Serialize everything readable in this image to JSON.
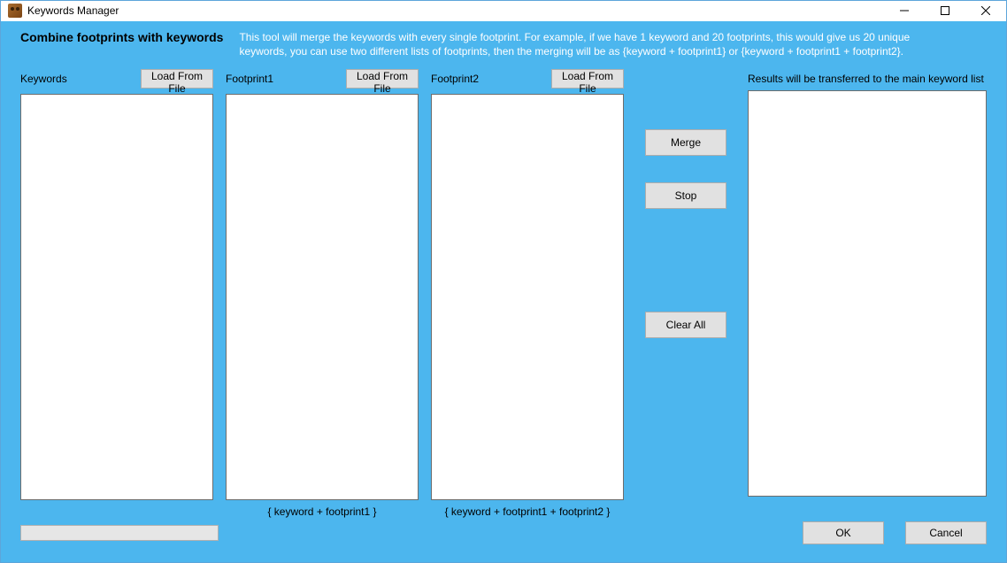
{
  "window": {
    "title": "Keywords Manager"
  },
  "header": {
    "heading": "Combine footprints with keywords",
    "description": "This tool will merge the keywords with every single footprint. For example, if we have 1 keyword and 20 footprints, this would give us 20 unique keywords, you can use two different lists of footprints, then the merging will be as {keyword + footprint1} or {keyword + footprint1 + footprint2}."
  },
  "columns": {
    "keywords": {
      "label": "Keywords",
      "load_btn": "Load From File",
      "value": ""
    },
    "footprint1": {
      "label": "Footprint1",
      "load_btn": "Load From File",
      "value": "",
      "hint": "{ keyword + footprint1 }"
    },
    "footprint2": {
      "label": "Footprint2",
      "load_btn": "Load From File",
      "value": "",
      "hint": "{ keyword + footprint1 + footprint2 }"
    }
  },
  "actions": {
    "merge": "Merge",
    "stop": "Stop",
    "clear_all": "Clear All"
  },
  "results": {
    "label": "Results will be transferred to the main keyword list",
    "value": ""
  },
  "footer": {
    "ok": "OK",
    "cancel": "Cancel"
  }
}
